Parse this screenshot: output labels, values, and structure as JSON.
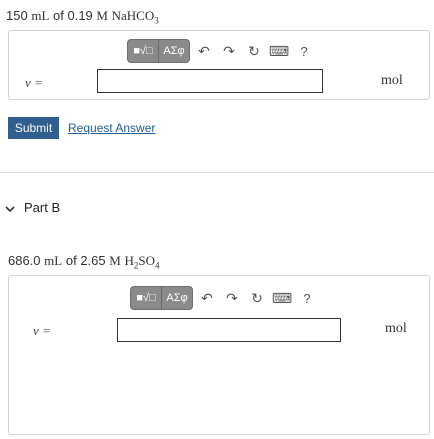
{
  "part_a": {
    "question": {
      "volume": "150",
      "volume_unit": "mL",
      "of_text": "of",
      "concentration": "0.19",
      "conc_unit": "M",
      "solute": "NaHCO",
      "solute_sub": "3"
    },
    "toolbar": {
      "templates": "■√□",
      "greek": "AΣφ",
      "undo": "↶",
      "redo": "↷",
      "reset": "↻",
      "keyboard": "⌨",
      "help": "?"
    },
    "variable": "ν =",
    "input_value": "",
    "unit": "mol"
  },
  "actions": {
    "submit": "Submit",
    "request": "Request Answer"
  },
  "part_b": {
    "collapse_icon": "chevron-down-icon",
    "label": "Part B",
    "question": {
      "volume": "686.0",
      "volume_unit": "mL",
      "of_text": "of",
      "concentration": "2.65",
      "conc_unit": "M",
      "solute_h": "H",
      "solute_h_sub": "2",
      "solute_rest": "SO",
      "solute_rest_sub": "4"
    },
    "toolbar": {
      "templates": "■√□",
      "greek": "AΣφ",
      "undo": "↶",
      "redo": "↷",
      "reset": "↻",
      "keyboard": "⌨",
      "help": "?"
    },
    "variable": "ν =",
    "input_value": "",
    "unit": "mol"
  }
}
